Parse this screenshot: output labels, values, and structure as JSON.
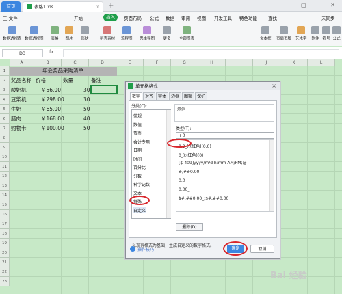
{
  "tabs": {
    "home": "首页",
    "file": "表格1.xls"
  },
  "menu": [
    "三 文件",
    "开始",
    "插入",
    "页面布局",
    "公式",
    "数据",
    "审阅",
    "视图",
    "开发工具",
    "特色功能",
    "查找",
    "未同步"
  ],
  "menu_active": "插入",
  "ribbon": [
    "数据透视表",
    "数据透视图",
    "表格",
    "图片",
    "形状",
    "稻壳素材",
    "流程图",
    "思维导图",
    "更多",
    "全部图表",
    "文本框",
    "页眉页脚",
    "艺术字",
    "附件",
    "符号",
    "公式"
  ],
  "formula_bar": {
    "namebox": "D3",
    "fx": "fx",
    "value": ""
  },
  "columns": [
    "A",
    "B",
    "C",
    "D",
    "E",
    "F",
    "G",
    "H",
    "I",
    "J",
    "K",
    "L"
  ],
  "rows": [
    "1",
    "2",
    "3",
    "4",
    "5",
    "6",
    "7",
    "8",
    "9",
    "10",
    "11",
    "12",
    "13",
    "14",
    "15",
    "16",
    "17",
    "18",
    "19",
    "20",
    "21",
    "22",
    "23"
  ],
  "sheet": {
    "title": "年会奖品采购清单",
    "headers": [
      "奖品名称",
      "价格",
      "数量",
      "备注"
    ],
    "data": [
      [
        "酸奶机",
        "￥56.00",
        "30"
      ],
      [
        "豆浆机",
        "￥298.00",
        "30"
      ],
      [
        "牛奶",
        "￥65.00",
        "50"
      ],
      [
        "腊肉",
        "￥168.00",
        "40"
      ],
      [
        "购物卡",
        "￥100.00",
        "50"
      ]
    ]
  },
  "dialog": {
    "title": "单元格格式",
    "close": "×",
    "tabs": [
      "数字",
      "对齐",
      "字体",
      "边框",
      "图案",
      "保护"
    ],
    "category_label": "分类(C):",
    "categories": [
      "常规",
      "数值",
      "货币",
      "会计专用",
      "日期",
      "时间",
      "百分比",
      "分数",
      "科学记数",
      "文本",
      "特殊",
      "自定义"
    ],
    "selected_category": "自定义",
    "sample_label": "示例",
    "type_label": "类型(T):",
    "type_value": "+0",
    "type_list": [
      "0.0_);(红色)(0.0)",
      "0_);(红色)(0)",
      "[$-409]yyyy/m/d h:mm AM/PM;@",
      "#,##0.00_",
      "0.0_",
      "0.00_",
      "$#,##0.00_;$#,##0.00"
    ],
    "delete_button": "删除(D)",
    "hint": "以现有格式为基础，生成自定义的数字格式。",
    "tips_link": "操作技巧",
    "ok": "确定",
    "cancel": "取消"
  },
  "watermark": "Bai 经验"
}
